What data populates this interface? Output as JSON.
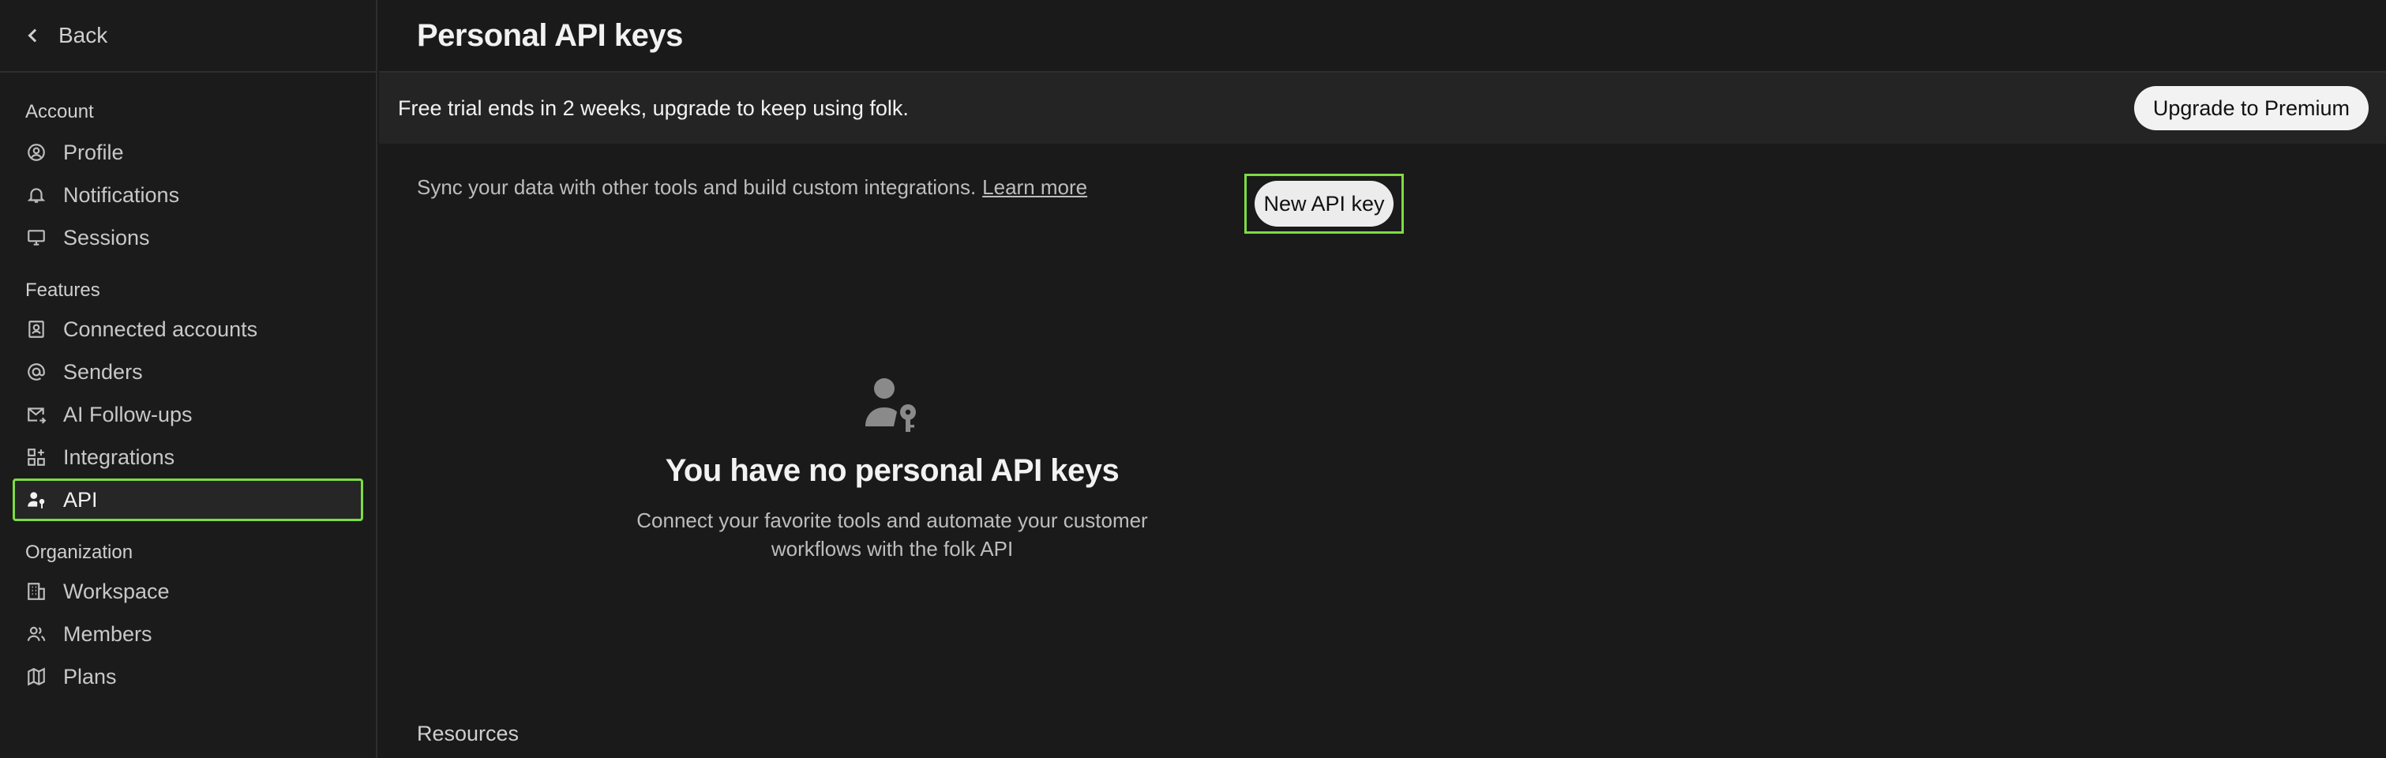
{
  "sidebar": {
    "back_label": "Back",
    "sections": {
      "account": {
        "title": "Account",
        "items": [
          {
            "label": "Profile",
            "icon": "user-circle-icon"
          },
          {
            "label": "Notifications",
            "icon": "bell-icon"
          },
          {
            "label": "Sessions",
            "icon": "monitor-icon"
          }
        ]
      },
      "features": {
        "title": "Features",
        "items": [
          {
            "label": "Connected accounts",
            "icon": "contact-card-icon"
          },
          {
            "label": "Senders",
            "icon": "at-sign-icon"
          },
          {
            "label": "AI Follow-ups",
            "icon": "mail-arrow-icon"
          },
          {
            "label": "Integrations",
            "icon": "grid-plus-icon"
          },
          {
            "label": "API",
            "icon": "user-key-icon",
            "active": true
          }
        ]
      },
      "organization": {
        "title": "Organization",
        "items": [
          {
            "label": "Workspace",
            "icon": "building-icon"
          },
          {
            "label": "Members",
            "icon": "users-icon"
          },
          {
            "label": "Plans",
            "icon": "map-icon"
          }
        ]
      }
    }
  },
  "header": {
    "title": "Personal API keys"
  },
  "banner": {
    "text": "Free trial ends in 2 weeks, upgrade to keep using folk.",
    "button_label": "Upgrade to Premium"
  },
  "intro": {
    "text": "Sync your data with other tools and build custom integrations.",
    "link_label": "Learn more",
    "button_label": "New API key"
  },
  "empty_state": {
    "icon": "user-key-icon",
    "title": "You have no personal API keys",
    "description": "Connect your favorite tools and automate your customer workflows with the folk API"
  },
  "resources": {
    "title": "Resources"
  },
  "colors": {
    "background": "#1a1a1a",
    "banner": "#242424",
    "highlight": "#7ddc43",
    "button": "#ececec"
  }
}
